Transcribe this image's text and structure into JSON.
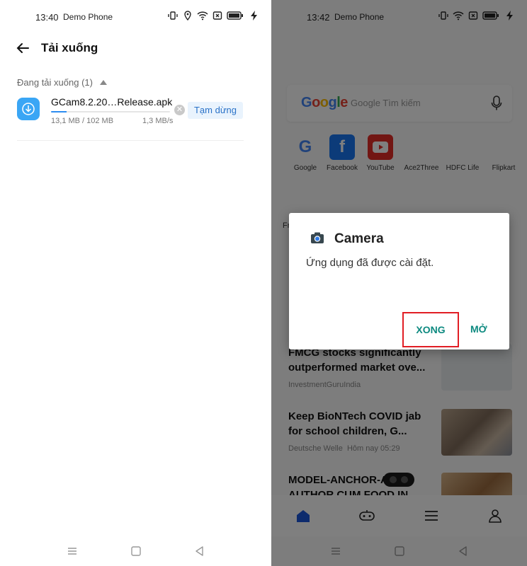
{
  "left": {
    "status": {
      "time": "13:40",
      "carrier": "Demo Phone"
    },
    "header": {
      "title": "Tải xuống"
    },
    "section_label": "Đang tải xuống (1)",
    "download": {
      "file_name": "GCam8.2.20…Release.apk",
      "size": "13,1 MB / 102 MB",
      "speed": "1,3 MB/s",
      "progress": 0.13,
      "pause_label": "Tạm dừng"
    }
  },
  "right": {
    "status": {
      "time": "13:42",
      "carrier": "Demo Phone"
    },
    "search": {
      "logo": "Google",
      "placeholder": "Google Tìm kiếm"
    },
    "apps": [
      {
        "label": "Google"
      },
      {
        "label": "Facebook"
      },
      {
        "label": "YouTube"
      },
      {
        "label": "Ace2Three"
      },
      {
        "label": "HDFC Life"
      },
      {
        "label": "Flipkart"
      }
    ],
    "feed_tab_fragment": "Fr",
    "news": [
      {
        "title": "FMCG stocks significantly outperformed market ove...",
        "source": "InvestmentGuruIndia"
      },
      {
        "title": "Keep BioNTech COVID jab for school children, G...",
        "source": "Deutsche Welle",
        "time": "Hôm nay 05:29"
      },
      {
        "title": "MODEL-ANCHOR-A... B-AUTHOR CUM FOOD IN",
        "source": ""
      }
    ],
    "dialog": {
      "title": "Camera",
      "message": "Ứng dụng đã được cài đặt.",
      "done_label": "XONG",
      "open_label": "MỞ"
    }
  },
  "colors": {
    "accent": "#0d8a80",
    "highlight_box": "#e11d24",
    "progress": "#2d8cf0",
    "pause_bg": "#e9f3fd"
  }
}
